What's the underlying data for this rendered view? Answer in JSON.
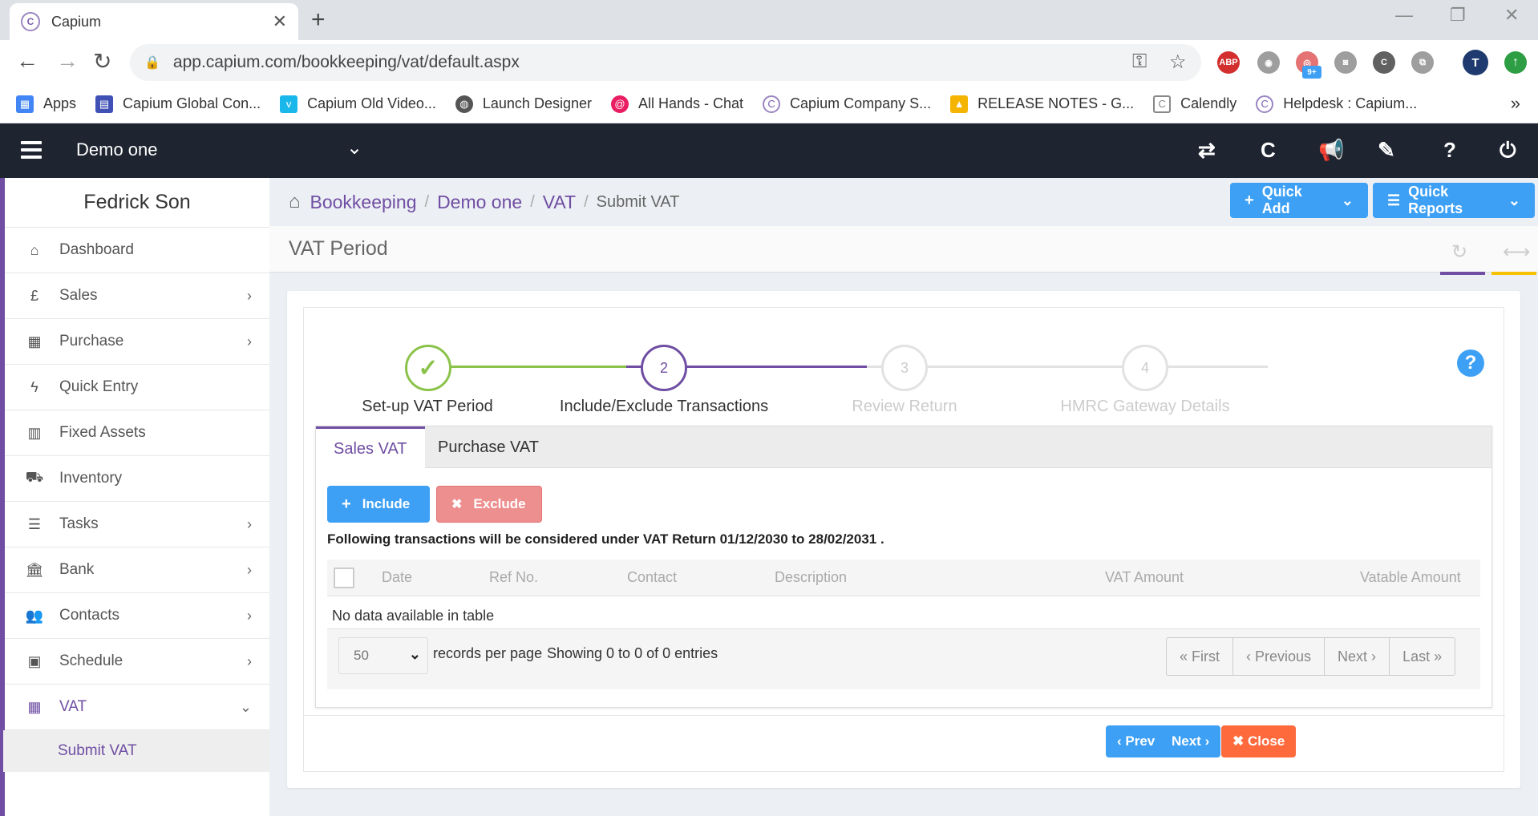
{
  "browser": {
    "tab_title": "Capium",
    "url": "app.capium.com/bookkeeping/vat/default.aspx",
    "extension_badge": "9+",
    "ext_abp": "ABP",
    "profile_initial": "T",
    "bookmarks": [
      {
        "label": "Apps",
        "icon": "apps-grid-icon",
        "color": "#4285f4"
      },
      {
        "label": "Capium Global Con...",
        "icon": "page-icon",
        "color": "#3f51b5"
      },
      {
        "label": "Capium Old Video...",
        "icon": "vimeo-icon",
        "color": "#1ab7ea"
      },
      {
        "label": "Launch Designer",
        "icon": "globe-icon",
        "color": "#555555"
      },
      {
        "label": "All Hands - Chat",
        "icon": "chat-icon",
        "color": "#e91e63"
      },
      {
        "label": "Capium Company S...",
        "icon": "capium-icon",
        "color": "#9b86c2"
      },
      {
        "label": "RELEASE NOTES - G...",
        "icon": "drive-icon",
        "color": "#f4b400"
      },
      {
        "label": "Calendly",
        "icon": "calendar-icon",
        "color": "#888888"
      },
      {
        "label": "Helpdesk : Capium...",
        "icon": "capium-icon",
        "color": "#9b86c2"
      }
    ],
    "more": "»"
  },
  "header": {
    "company": "Demo one"
  },
  "sidebar": {
    "user": "Fedrick Son",
    "items": [
      {
        "label": "Dashboard",
        "icon": "home-icon",
        "chevron": false
      },
      {
        "label": "Sales",
        "icon": "pound-icon",
        "chevron": true
      },
      {
        "label": "Purchase",
        "icon": "qr-icon",
        "chevron": true
      },
      {
        "label": "Quick Entry",
        "icon": "bolt-icon",
        "chevron": false
      },
      {
        "label": "Fixed Assets",
        "icon": "building-icon",
        "chevron": false
      },
      {
        "label": "Inventory",
        "icon": "truck-icon",
        "chevron": false
      },
      {
        "label": "Tasks",
        "icon": "tasks-icon",
        "chevron": true
      },
      {
        "label": "Bank",
        "icon": "bank-icon",
        "chevron": true
      },
      {
        "label": "Contacts",
        "icon": "users-icon",
        "chevron": true
      },
      {
        "label": "Schedule",
        "icon": "calendar-icon",
        "chevron": true
      },
      {
        "label": "VAT",
        "icon": "calculator-icon",
        "chevron": true
      }
    ],
    "submenu": "Submit VAT"
  },
  "breadcrumb": {
    "items": [
      "Bookkeeping",
      "Demo one",
      "VAT"
    ],
    "current": "Submit VAT"
  },
  "toolbar": {
    "quick_add": "Quick Add",
    "quick_reports": "Quick Reports"
  },
  "section": {
    "title": "VAT Period"
  },
  "stepper": {
    "steps": [
      {
        "number": "",
        "label": "Set-up VAT Period",
        "state": "done"
      },
      {
        "number": "2",
        "label": "Include/Exclude Transactions",
        "state": "active"
      },
      {
        "number": "3",
        "label": "Review Return",
        "state": "pending"
      },
      {
        "number": "4",
        "label": "HMRC Gateway Details",
        "state": "pending"
      }
    ],
    "help": "?"
  },
  "tabs": {
    "sales": "Sales VAT",
    "purchase": "Purchase VAT"
  },
  "actions": {
    "include": "Include",
    "exclude": "Exclude"
  },
  "notice": "Following transactions will be considered under VAT Return 01/12/2030 to 28/02/2031 .",
  "table": {
    "columns": [
      "Date",
      "Ref No.",
      "Contact",
      "Description",
      "VAT Amount",
      "Vatable Amount"
    ],
    "empty": "No data available in table",
    "per_page": "50",
    "per_page_label": "records per page",
    "info": "Showing 0 to 0 of 0 entries",
    "pager": {
      "first": "« First",
      "previous": "‹ Previous",
      "next": "Next ›",
      "last": "Last »"
    }
  },
  "footer": {
    "prev": "‹ Prev",
    "next": "Next ›",
    "close": "✖ Close"
  },
  "colors": {
    "brand_purple": "#6f4ea3",
    "primary_blue": "#3da0f5",
    "success_green": "#8bc34a",
    "exclude_red": "#ee8f8f",
    "close_orange": "#ff6a3d"
  }
}
